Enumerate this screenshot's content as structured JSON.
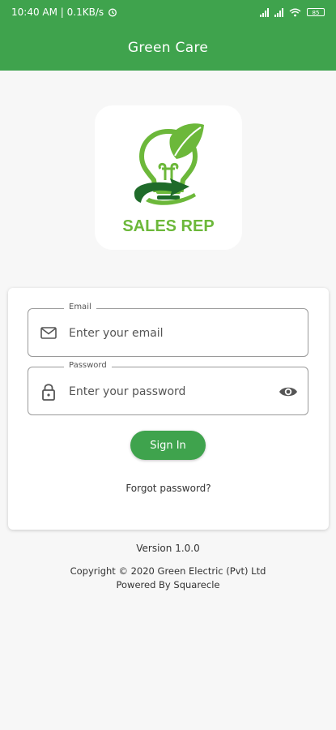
{
  "status_bar": {
    "time_info": "10:40 AM | 0.1KB/s",
    "alarm_icon": "alarm-icon",
    "signal_icon": "signal-icon",
    "wifi_icon": "wifi-icon",
    "battery_level": "85"
  },
  "app_bar": {
    "title": "Green Care"
  },
  "logo": {
    "icon": "lightbulb-leaf-icon",
    "caption": "SALES REP"
  },
  "form": {
    "email": {
      "label": "Email",
      "placeholder": "Enter your email",
      "value": "",
      "icon": "mail-icon"
    },
    "password": {
      "label": "Password",
      "placeholder": "Enter your password",
      "value": "",
      "icon": "lock-icon",
      "toggle_icon": "eye-icon"
    },
    "signin_label": "Sign In",
    "forgot_label": "Forgot password?"
  },
  "footer": {
    "version": "Version 1.0.0",
    "copyright": "Copyright © 2020 Green Electric (Pvt) Ltd",
    "powered": "Powered By Squarecle"
  },
  "colors": {
    "primary": "#3fa34d",
    "logo_green": "#6cb83a",
    "dark_green": "#1f6b2a",
    "background": "#f7f7f7"
  }
}
